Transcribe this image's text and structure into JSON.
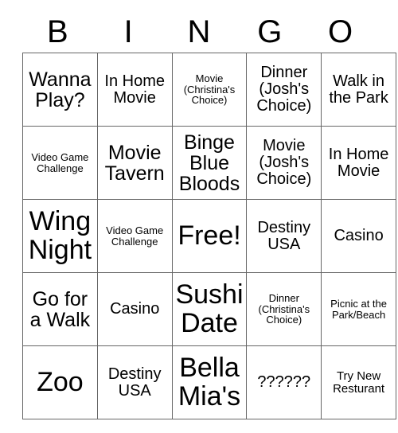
{
  "card": {
    "headers": [
      "B",
      "I",
      "N",
      "G",
      "O"
    ],
    "rows": [
      [
        {
          "text": "Wanna Play?",
          "size": "fs-lg"
        },
        {
          "text": "In Home Movie",
          "size": "fs-md"
        },
        {
          "text": "Movie (Christina's Choice)",
          "size": "fs-xs"
        },
        {
          "text": "Dinner (Josh's Choice)",
          "size": "fs-md"
        },
        {
          "text": "Walk in the Park",
          "size": "fs-md"
        }
      ],
      [
        {
          "text": "Video Game Challenge",
          "size": "fs-xs"
        },
        {
          "text": "Movie Tavern",
          "size": "fs-lg"
        },
        {
          "text": "Binge Blue Bloods",
          "size": "fs-lg"
        },
        {
          "text": "Movie (Josh's Choice)",
          "size": "fs-md"
        },
        {
          "text": "In Home Movie",
          "size": "fs-md"
        }
      ],
      [
        {
          "text": "Wing Night",
          "size": "fs-xxl"
        },
        {
          "text": "Video Game Challenge",
          "size": "fs-xs"
        },
        {
          "text": "Free!",
          "size": "fs-xxl"
        },
        {
          "text": "Destiny USA",
          "size": "fs-md"
        },
        {
          "text": "Casino",
          "size": "fs-md"
        }
      ],
      [
        {
          "text": "Go for a Walk",
          "size": "fs-lg"
        },
        {
          "text": "Casino",
          "size": "fs-md"
        },
        {
          "text": "Sushi Date",
          "size": "fs-xxl"
        },
        {
          "text": "Dinner (Christina's Choice)",
          "size": "fs-xs"
        },
        {
          "text": "Picnic at the Park/Beach",
          "size": "fs-xs"
        }
      ],
      [
        {
          "text": "Zoo",
          "size": "fs-xxl"
        },
        {
          "text": "Destiny USA",
          "size": "fs-md"
        },
        {
          "text": "Bella Mia's",
          "size": "fs-xxl"
        },
        {
          "text": "??????",
          "size": "fs-md"
        },
        {
          "text": "Try New Resturant",
          "size": "fs-sm"
        }
      ]
    ]
  }
}
